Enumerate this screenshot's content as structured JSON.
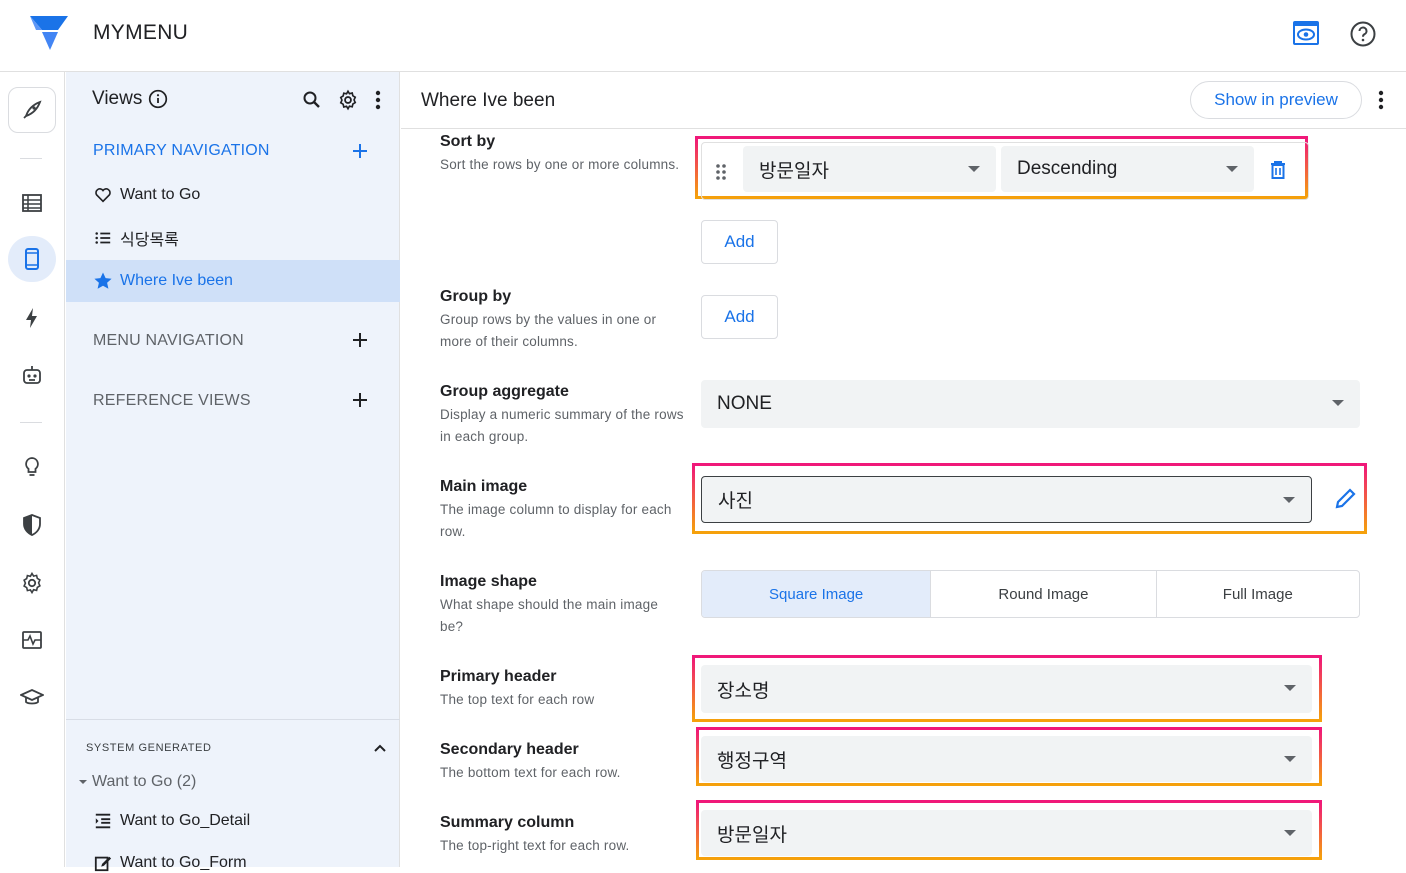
{
  "app": {
    "title": "MYMENU"
  },
  "views_panel": {
    "title": "Views",
    "sections": {
      "primary": "PRIMARY NAVIGATION",
      "menu": "MENU NAVIGATION",
      "reference": "REFERENCE VIEWS"
    },
    "primary_items": [
      {
        "label": "Want to Go",
        "icon": "heart-icon"
      },
      {
        "label": "식당목록",
        "icon": "list-icon"
      },
      {
        "label": "Where Ive been",
        "icon": "star-icon",
        "selected": true
      }
    ],
    "system": {
      "label": "SYSTEM GENERATED",
      "group": "Want to Go (2)",
      "items": [
        {
          "label": "Want to Go_Detail",
          "icon": "detail-icon"
        },
        {
          "label": "Want to Go_Form",
          "icon": "form-edit-icon"
        }
      ]
    }
  },
  "main": {
    "title": "Where Ive been",
    "preview_button": "Show in preview",
    "sort_by": {
      "label": "Sort by",
      "desc": "Sort the rows by one or more columns.",
      "column": "방문일자",
      "order": "Descending",
      "add": "Add"
    },
    "group_by": {
      "label": "Group by",
      "desc": "Group rows by the values in one or more of their columns.",
      "add": "Add"
    },
    "group_aggregate": {
      "label": "Group aggregate",
      "desc": "Display a numeric summary of the rows in each group.",
      "value": "NONE"
    },
    "main_image": {
      "label": "Main image",
      "desc": "The image column to display for each row.",
      "value": "사진"
    },
    "image_shape": {
      "label": "Image shape",
      "desc": "What shape should the main image be?",
      "options": [
        "Square Image",
        "Round Image",
        "Full Image"
      ],
      "selected": "Square Image"
    },
    "primary_header": {
      "label": "Primary header",
      "desc": "The top text for each row",
      "value": "장소명"
    },
    "secondary_header": {
      "label": "Secondary header",
      "desc": "The bottom text for each row.",
      "value": "행정구역"
    },
    "summary_column": {
      "label": "Summary column",
      "desc": "The top-right text for each row.",
      "value": "방문일자"
    }
  },
  "colors": {
    "accent": "#1a73e8",
    "highlight_top": "#f0177a",
    "highlight_bottom": "#f5a10b",
    "panel_bg": "#eef3fb"
  }
}
